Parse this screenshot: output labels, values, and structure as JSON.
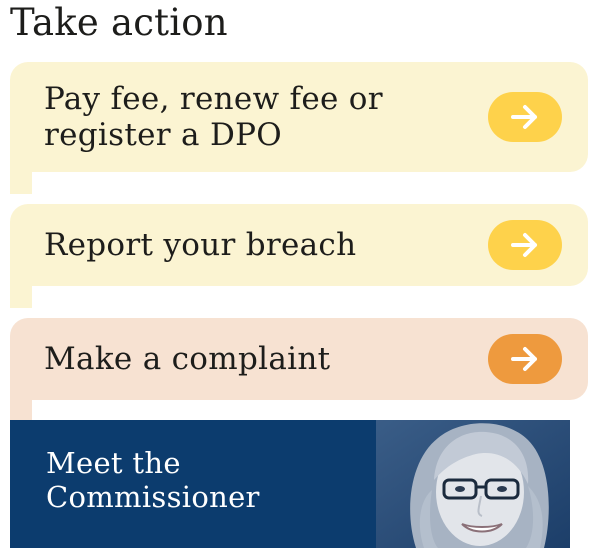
{
  "take_action": {
    "title": "Take action",
    "cards": [
      {
        "label_line1": "Pay fee, renew fee or",
        "label_line2": "register a DPO",
        "theme": "yellow",
        "arrow_icon": "arrow-right-icon"
      },
      {
        "label": "Report your breach",
        "theme": "yellow",
        "arrow_icon": "arrow-right-icon"
      },
      {
        "label": "Make a complaint",
        "theme": "orange",
        "arrow_icon": "arrow-right-icon"
      }
    ],
    "promo": {
      "label_line1": "Meet the",
      "label_line2": "Commissioner",
      "image": "commissioner-portrait"
    }
  },
  "colors": {
    "yellow_card_bg": "#fbf4d2",
    "yellow_button": "#fed24b",
    "orange_card_bg": "#f7e2d2",
    "orange_button": "#ee9a3e",
    "promo_bg": "#0c3c6e",
    "text": "#1d1d1b"
  }
}
